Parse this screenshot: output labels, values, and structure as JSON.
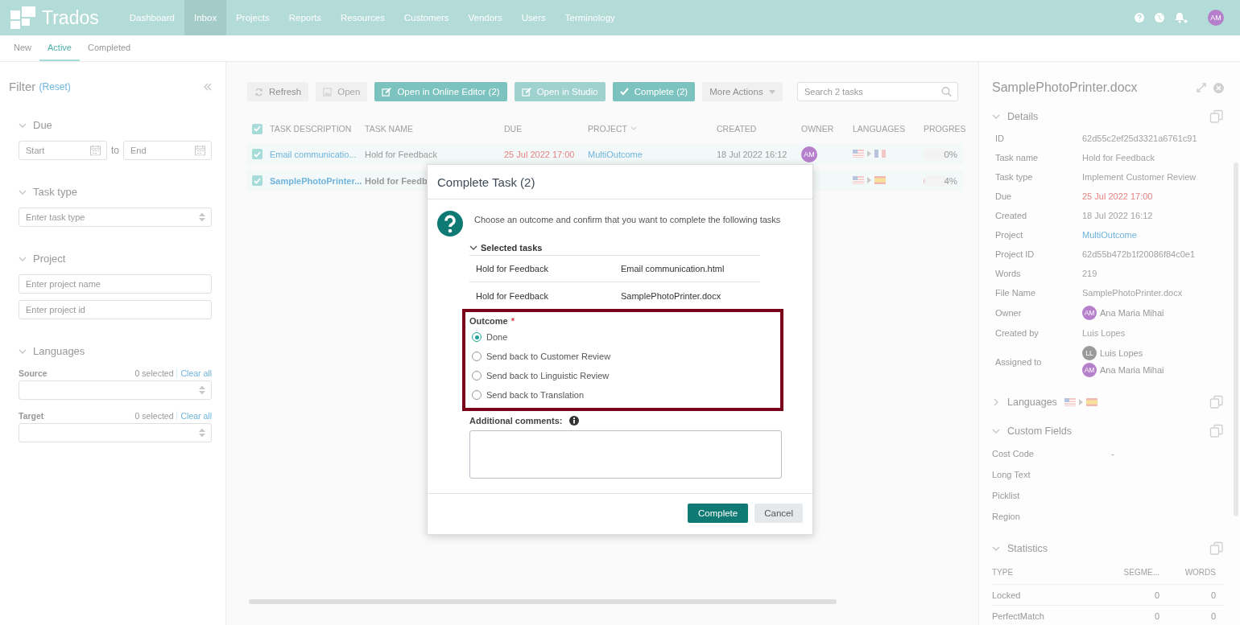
{
  "nav": {
    "logo": "Trados",
    "items": [
      {
        "label": "Dashboard",
        "selected": false
      },
      {
        "label": "Inbox",
        "selected": true
      },
      {
        "label": "Projects",
        "selected": false
      },
      {
        "label": "Reports",
        "selected": false
      },
      {
        "label": "Resources",
        "selected": false
      },
      {
        "label": "Customers",
        "selected": false
      },
      {
        "label": "Vendors",
        "selected": false
      },
      {
        "label": "Users",
        "selected": false
      },
      {
        "label": "Terminology",
        "selected": false
      }
    ],
    "avatar": "AM"
  },
  "subtabs": [
    {
      "label": "New",
      "selected": false
    },
    {
      "label": "Active",
      "selected": true
    },
    {
      "label": "Completed",
      "selected": false
    }
  ],
  "filter": {
    "title": "Filter",
    "reset": "(Reset)",
    "sections": [
      {
        "kind": "dates",
        "label": "Due",
        "expanded": true,
        "start_placeholder": "Start",
        "joiner": "to",
        "end_placeholder": "End"
      },
      {
        "kind": "select",
        "label": "Task type",
        "expanded": true,
        "placeholder": "Enter task type"
      },
      {
        "kind": "inputs",
        "label": "Project",
        "expanded": true,
        "placeholders": [
          "Enter project name",
          "Enter project id"
        ]
      },
      {
        "kind": "languages",
        "label": "Languages",
        "expanded": true,
        "pickers": [
          {
            "label": "Source",
            "count": "0 selected",
            "clear": "Clear all"
          },
          {
            "label": "Target",
            "count": "0 selected",
            "clear": "Clear all"
          }
        ]
      }
    ]
  },
  "toolbar": {
    "buttons": [
      {
        "label": "Refresh",
        "kind": "refresh",
        "primary": false,
        "disabled": false
      },
      {
        "label": "Open",
        "kind": "open",
        "primary": false,
        "disabled": true
      },
      {
        "label": "Open in Online Editor (2)",
        "kind": "edit",
        "primary": true,
        "disabled": false
      },
      {
        "label": "Open in Studio",
        "kind": "edit",
        "primary": true,
        "disabled": true
      },
      {
        "label": "Complete (2)",
        "kind": "check",
        "primary": true,
        "disabled": false
      },
      {
        "label": "More Actions",
        "kind": "dropdown",
        "primary": false,
        "disabled": false
      }
    ],
    "search": {
      "placeholder": "Search 2 tasks"
    }
  },
  "table": {
    "all_checked": true,
    "columns": [
      {
        "label": "TASK DESCRIPTION"
      },
      {
        "label": "TASK NAME"
      },
      {
        "label": "DUE"
      },
      {
        "label": "PROJECT",
        "sorted": true
      },
      {
        "label": "CREATED"
      },
      {
        "label": "OWNER"
      },
      {
        "label": "LANGUAGES"
      },
      {
        "label": "PROGRES"
      }
    ],
    "rows": [
      {
        "checked": true,
        "selected": false,
        "description": "Email communicatio...",
        "task_name": "Hold for Feedback",
        "due": "25 Jul 2022 17:00",
        "project": "MultiOutcome",
        "created": "18 Jul 2022 16:12",
        "owner": "AM",
        "flags": [
          {
            "kind": "us"
          },
          {
            "kind": "fr"
          }
        ],
        "progress": "0%",
        "level": 0
      },
      {
        "checked": true,
        "selected": true,
        "description": "SamplePhotoPrinter...",
        "task_name": "Hold for Feedb",
        "flags": [
          {
            "kind": "us"
          },
          {
            "kind": "es"
          }
        ],
        "progress": "4%",
        "level": 0.04
      }
    ]
  },
  "details": {
    "title": "SamplePhotoPrinter.docx",
    "sections": [
      {
        "kind": "fields",
        "label": "Details",
        "expanded": true,
        "rows": [
          {
            "label": "ID",
            "value": "62d55c2ef25d3321a6761c91",
            "kind": "text"
          },
          {
            "label": "Task name",
            "value": "Hold for Feedback",
            "kind": "text"
          },
          {
            "label": "Task type",
            "value": "Implement Customer Review",
            "kind": "text"
          },
          {
            "label": "Due",
            "value": "25 Jul 2022 17:00",
            "kind": "overdue"
          },
          {
            "label": "Created",
            "value": "18 Jul 2022 16:12",
            "kind": "text"
          },
          {
            "label": "Project",
            "value": "MultiOutcome",
            "kind": "link"
          },
          {
            "label": "Project ID",
            "value": "62d55b472b1f20086f84c0e1",
            "kind": "text"
          },
          {
            "label": "Words",
            "value": "219",
            "kind": "text"
          },
          {
            "label": "File Name",
            "value": "SamplePhotoPrinter.docx",
            "kind": "text"
          },
          {
            "label": "Owner",
            "kind": "people",
            "people": [
              {
                "initials": "AM",
                "name": "Ana Maria Mihai",
                "color": "#b57fcc"
              }
            ]
          },
          {
            "label": "Created by",
            "value": "Luis Lopes",
            "kind": "text"
          },
          {
            "label": "Assigned to",
            "kind": "people",
            "people": [
              {
                "initials": "LL",
                "name": "Luis Lopes",
                "color": "#9a9a9a"
              },
              {
                "initials": "AM",
                "name": "Ana Maria Mihai",
                "color": "#b57fcc"
              }
            ]
          }
        ]
      },
      {
        "kind": "languages",
        "label": "Languages",
        "expanded": false,
        "flags": [
          {
            "kind": "us"
          },
          {
            "kind": "es"
          }
        ]
      },
      {
        "kind": "custom",
        "label": "Custom Fields",
        "expanded": true,
        "rows": [
          {
            "label": "Cost Code",
            "value": "-"
          },
          {
            "label": "Long Text"
          },
          {
            "label": "Picklist"
          },
          {
            "label": "Region"
          }
        ]
      },
      {
        "kind": "stats",
        "label": "Statistics",
        "expanded": true,
        "columns": [
          "TYPE",
          "SEGME...",
          "WORDS"
        ],
        "rows": [
          [
            "Locked",
            "0",
            "0"
          ],
          [
            "PerfectMatch",
            "0",
            "0"
          ]
        ]
      }
    ]
  },
  "modal": {
    "title": "Complete Task (2)",
    "message": "Choose an outcome and confirm that you want to complete the following tasks",
    "selected_tasks": {
      "label": "Selected tasks",
      "expanded": true,
      "rows": [
        {
          "task": "Hold for Feedback",
          "file": "Email communication.html"
        },
        {
          "task": "Hold for Feedback",
          "file": "SamplePhotoPrinter.docx"
        }
      ]
    },
    "outcome": {
      "label": "Outcome",
      "required": "*",
      "highlighted": true,
      "options": [
        {
          "label": "Done",
          "selected": true
        },
        {
          "label": "Send back to Customer Review",
          "selected": false
        },
        {
          "label": "Send back to Linguistic Review",
          "selected": false
        },
        {
          "label": "Send back to Translation",
          "selected": false
        }
      ]
    },
    "comments": {
      "label": "Additional comments:"
    },
    "buttons": [
      {
        "label": "Complete",
        "primary": true
      },
      {
        "label": "Cancel",
        "primary": false
      }
    ]
  }
}
